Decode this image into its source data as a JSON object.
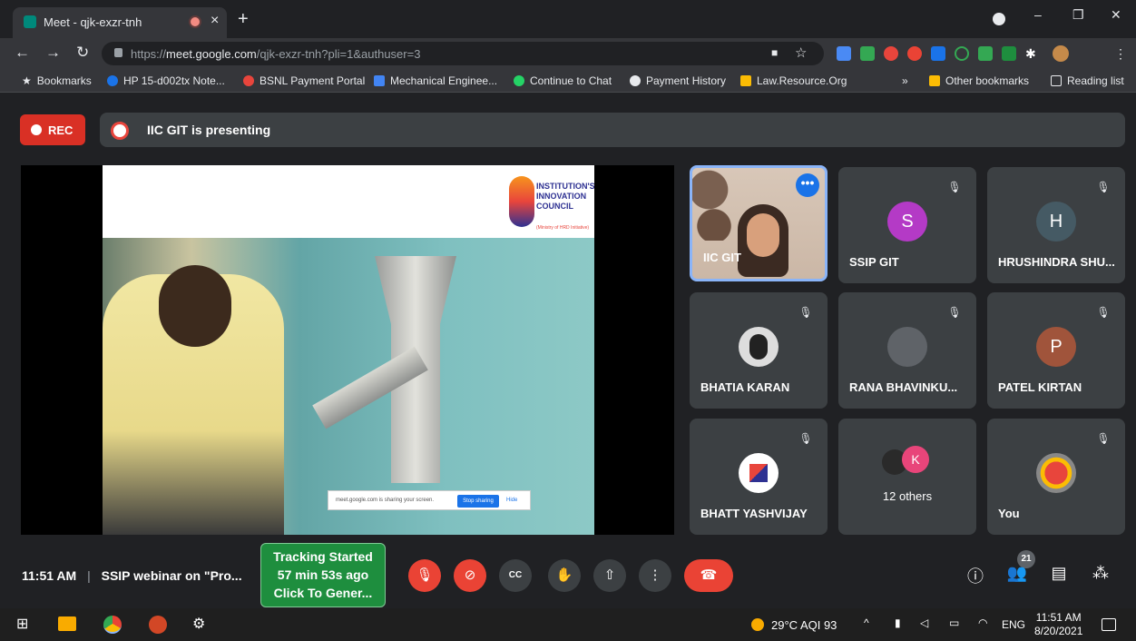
{
  "browser": {
    "tab_title": "Meet - qjk-exzr-tnh",
    "tab_close": "×",
    "new_tab": "+",
    "url_scheme": "https://",
    "url_host": "meet.google.com",
    "url_path": "/qjk-exzr-tnh?pli=1&authuser=3",
    "window_controls": {
      "minimize": "–",
      "maximize": "❐",
      "close": "✕"
    },
    "nav": {
      "back": "←",
      "forward": "→",
      "reload": "↻"
    }
  },
  "bookmarks": {
    "items": [
      {
        "label": "Bookmarks",
        "icon": "star-icon"
      },
      {
        "label": "HP 15-d002tx Note...",
        "icon": "hp-icon",
        "color": "#1a73e8"
      },
      {
        "label": "BSNL Payment Portal",
        "icon": "bsnl-icon",
        "color": "#e8453c"
      },
      {
        "label": "Mechanical Enginee...",
        "icon": "book-icon",
        "color": "#4285f4"
      },
      {
        "label": "Continue to Chat",
        "icon": "whatsapp-icon",
        "color": "#25d366"
      },
      {
        "label": "Payment History",
        "icon": "globe-icon",
        "color": "#e8eaed"
      },
      {
        "label": "Law.Resource.Org",
        "icon": "law-icon",
        "color": "#fbbc04"
      }
    ],
    "overflow": "»",
    "other": "Other bookmarks",
    "reading_list": "Reading list"
  },
  "meet": {
    "rec_label": "REC",
    "presenting": "IIC GIT is presenting",
    "slide": {
      "logo_line1": "INSTITUTION'S",
      "logo_line2": "INNOVATION",
      "logo_line3": "COUNCIL",
      "logo_sub": "(Ministry of HRD Initiative)",
      "share_msg": "meet.google.com is sharing your screen.",
      "stop_sharing": "Stop sharing",
      "hide": "Hide"
    },
    "participants": [
      {
        "name": "IIC GIT"
      },
      {
        "name": "SSIP GIT",
        "initial": "S",
        "color": "#b43ac6"
      },
      {
        "name": "HRUSHINDRA SHU...",
        "initial": "H",
        "color": "#455a64"
      },
      {
        "name": "BHATIA KARAN"
      },
      {
        "name": "RANA BHAVINKU..."
      },
      {
        "name": "PATEL KIRTAN",
        "initial": "P",
        "color": "#a0543b"
      },
      {
        "name": "BHATT YASHVIJAY"
      },
      {
        "name": "12 others",
        "initial": "K",
        "color": "#e8457a"
      },
      {
        "name": "You"
      }
    ],
    "more_icon": "•••",
    "mute_icon": "🎙"
  },
  "controls": {
    "time": "11:51 AM",
    "separator": "|",
    "meeting_title": "SSIP webinar on \"Pro...",
    "tracking": {
      "line1": "Tracking Started",
      "line2": "57 min 53s ago",
      "line3": "Click To Gener..."
    },
    "people_count": "21"
  },
  "taskbar": {
    "weather": "29°C  AQI 93",
    "lang": "ENG",
    "clock_time": "11:51 AM",
    "clock_date": "8/20/2021"
  }
}
